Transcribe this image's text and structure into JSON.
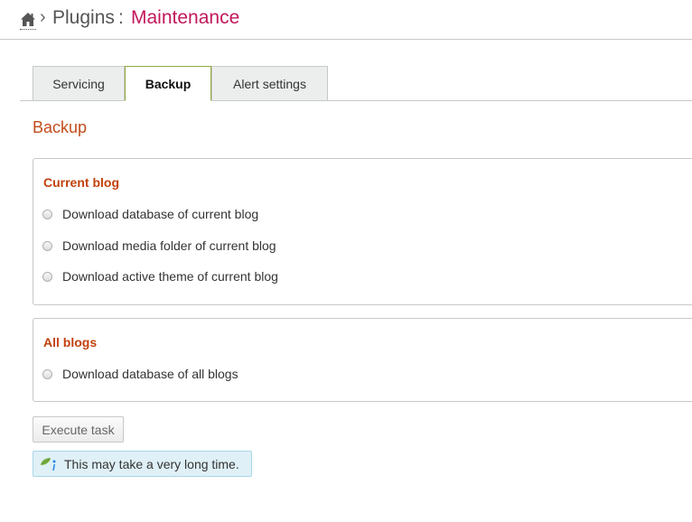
{
  "breadcrumb": {
    "home_icon": "home-icon",
    "separator": "›",
    "parent": "Plugins",
    "colon": ":",
    "current": "Maintenance"
  },
  "tabs": [
    {
      "label": "Servicing",
      "active": false
    },
    {
      "label": "Backup",
      "active": true
    },
    {
      "label": "Alert settings",
      "active": false
    }
  ],
  "section": {
    "title": "Backup"
  },
  "current_blog": {
    "title": "Current blog",
    "options": [
      {
        "label": "Download database of current blog",
        "checked": false
      },
      {
        "label": "Download media folder of current blog",
        "checked": false
      },
      {
        "label": "Download active theme of current blog",
        "checked": false
      }
    ]
  },
  "all_blogs": {
    "title": "All blogs",
    "options": [
      {
        "label": "Download database of all blogs",
        "checked": false
      }
    ]
  },
  "execute_button": {
    "label": "Execute task"
  },
  "info": {
    "icon": "info-leaf-icon",
    "text": "This may take a very long time."
  },
  "colors": {
    "accent_title": "#c24c1c",
    "breadcrumb_current": "#c2185b",
    "active_tab_border": "#8bab3c",
    "info_background": "#dff0f7"
  }
}
